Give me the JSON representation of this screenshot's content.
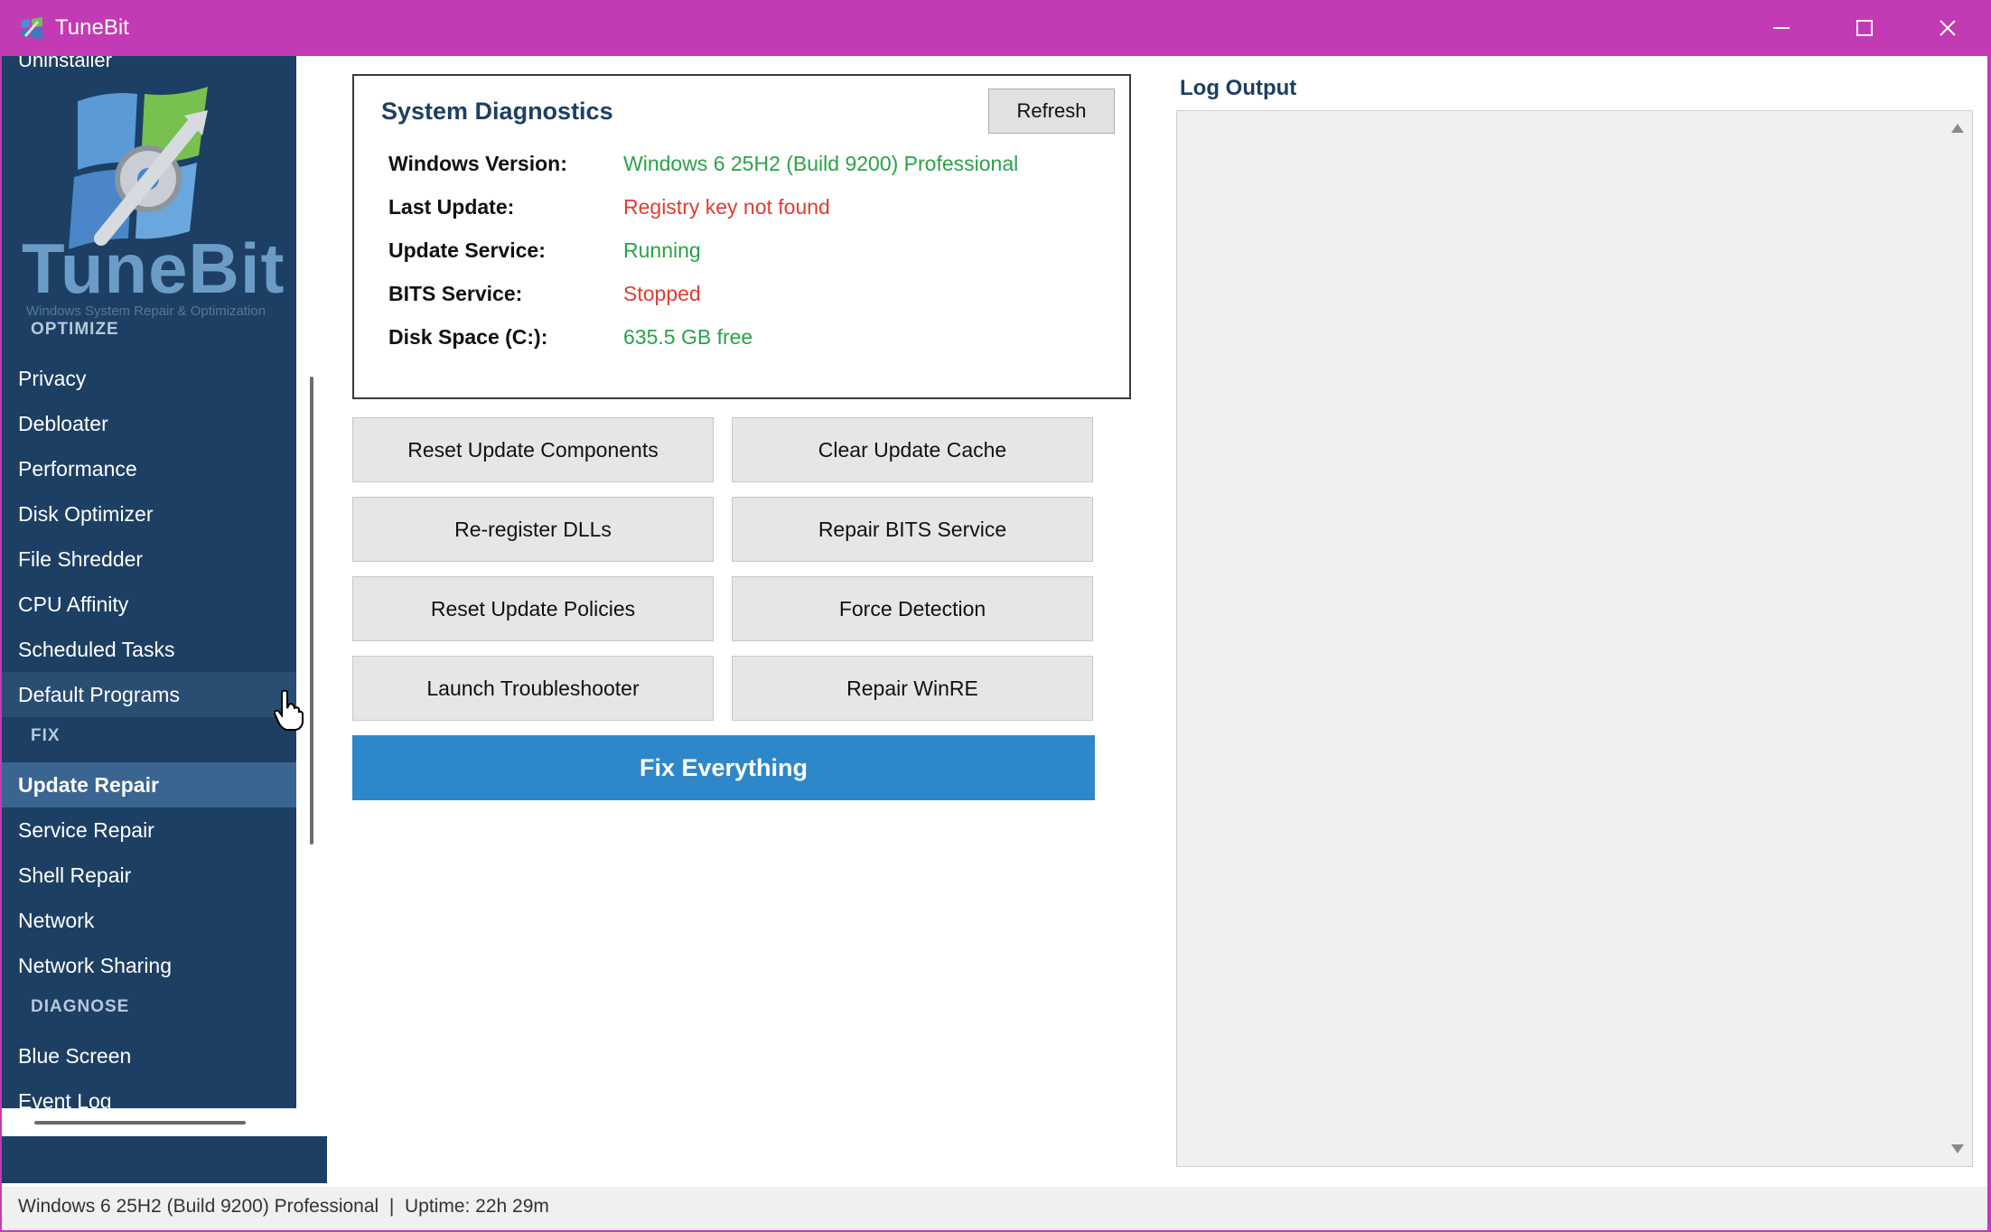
{
  "window": {
    "title": "TuneBit"
  },
  "sidebar": {
    "cut_item": "Uninstaller",
    "logo_word": "TuneBit",
    "logo_sub": "Windows System Repair & Optimization",
    "sections": {
      "optimize": "OPTIMIZE",
      "fix": "FIX",
      "diagnose": "DIAGNOSE"
    },
    "optimize_items": [
      "Privacy",
      "Debloater",
      "Performance",
      "Disk Optimizer",
      "File Shredder",
      "CPU Affinity",
      "Scheduled Tasks",
      "Default Programs"
    ],
    "fix_items": [
      "Update Repair",
      "Service Repair",
      "Shell Repair",
      "Network",
      "Network Sharing"
    ],
    "diagnose_items": [
      "Blue Screen",
      "Event Log"
    ],
    "active_item": "Update Repair",
    "hovered_item": "Default Programs"
  },
  "diagnostics": {
    "title": "System Diagnostics",
    "refresh_label": "Refresh",
    "rows": [
      {
        "label": "Windows Version:",
        "value": "Windows 6 25H2 (Build 9200) Professional",
        "status": "ok"
      },
      {
        "label": "Last Update:",
        "value": "Registry key not found",
        "status": "bad"
      },
      {
        "label": "Update Service:",
        "value": "Running",
        "status": "ok"
      },
      {
        "label": "BITS Service:",
        "value": "Stopped",
        "status": "bad"
      },
      {
        "label": "Disk Space (C:):",
        "value": "635.5 GB free",
        "status": "ok"
      }
    ]
  },
  "actions": {
    "reset_components": "Reset Update Components",
    "clear_cache": "Clear Update Cache",
    "reregister_dlls": "Re-register DLLs",
    "repair_bits": "Repair BITS Service",
    "reset_policies": "Reset Update Policies",
    "force_detection": "Force Detection",
    "launch_troubleshooter": "Launch Troubleshooter",
    "repair_winre": "Repair WinRE",
    "fix_everything": "Fix Everything"
  },
  "log": {
    "title": "Log Output"
  },
  "status_bar": {
    "text": "Windows 6 25H2 (Build 9200) Professional  |  Uptime: 22h 29m"
  },
  "colors": {
    "titlebar": "#c33bb4",
    "sidebar": "#1d3f63",
    "accent": "#2e87c8",
    "ok": "#2aa148",
    "bad": "#e03c31"
  }
}
